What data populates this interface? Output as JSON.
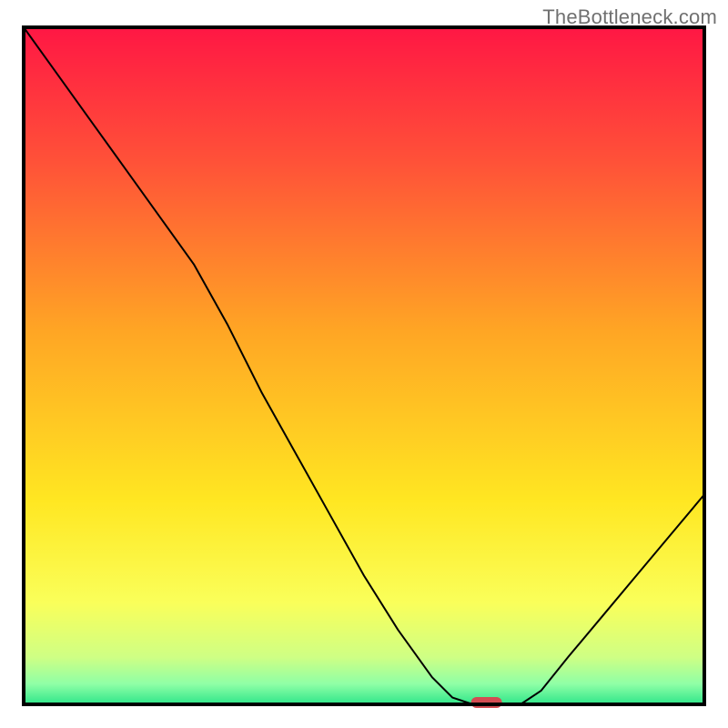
{
  "watermark": "TheBottleneck.com",
  "chart_data": {
    "type": "line",
    "title": "",
    "xlabel": "",
    "ylabel": "",
    "xlim": [
      0,
      100
    ],
    "ylim": [
      0,
      100
    ],
    "series": [
      {
        "name": "curve",
        "x": [
          0,
          5,
          10,
          15,
          20,
          25,
          30,
          35,
          40,
          45,
          50,
          55,
          60,
          63,
          66,
          70,
          73,
          76,
          80,
          85,
          90,
          95,
          100
        ],
        "y": [
          100,
          93,
          86,
          79,
          72,
          65,
          56,
          46,
          37,
          28,
          19,
          11,
          4,
          1,
          0,
          0,
          0,
          2,
          7,
          13,
          19,
          25,
          31
        ]
      }
    ],
    "flat_region": {
      "x_start": 64,
      "x_end": 72,
      "y": 0
    },
    "marker": {
      "x": 68,
      "y": 0,
      "shape": "rounded-pill",
      "color": "#d34c52"
    },
    "frame": {
      "stroke": "#000000",
      "stroke_width": 4
    },
    "line_style": {
      "stroke": "#000000",
      "stroke_width": 2
    },
    "background_gradient": {
      "type": "vertical",
      "stops": [
        {
          "offset": 0.0,
          "color": "#ff1744"
        },
        {
          "offset": 0.2,
          "color": "#ff5238"
        },
        {
          "offset": 0.45,
          "color": "#ffa624"
        },
        {
          "offset": 0.7,
          "color": "#ffe722"
        },
        {
          "offset": 0.85,
          "color": "#faff5a"
        },
        {
          "offset": 0.93,
          "color": "#cfff84"
        },
        {
          "offset": 0.97,
          "color": "#8fffa6"
        },
        {
          "offset": 1.0,
          "color": "#2fe68a"
        }
      ]
    }
  }
}
